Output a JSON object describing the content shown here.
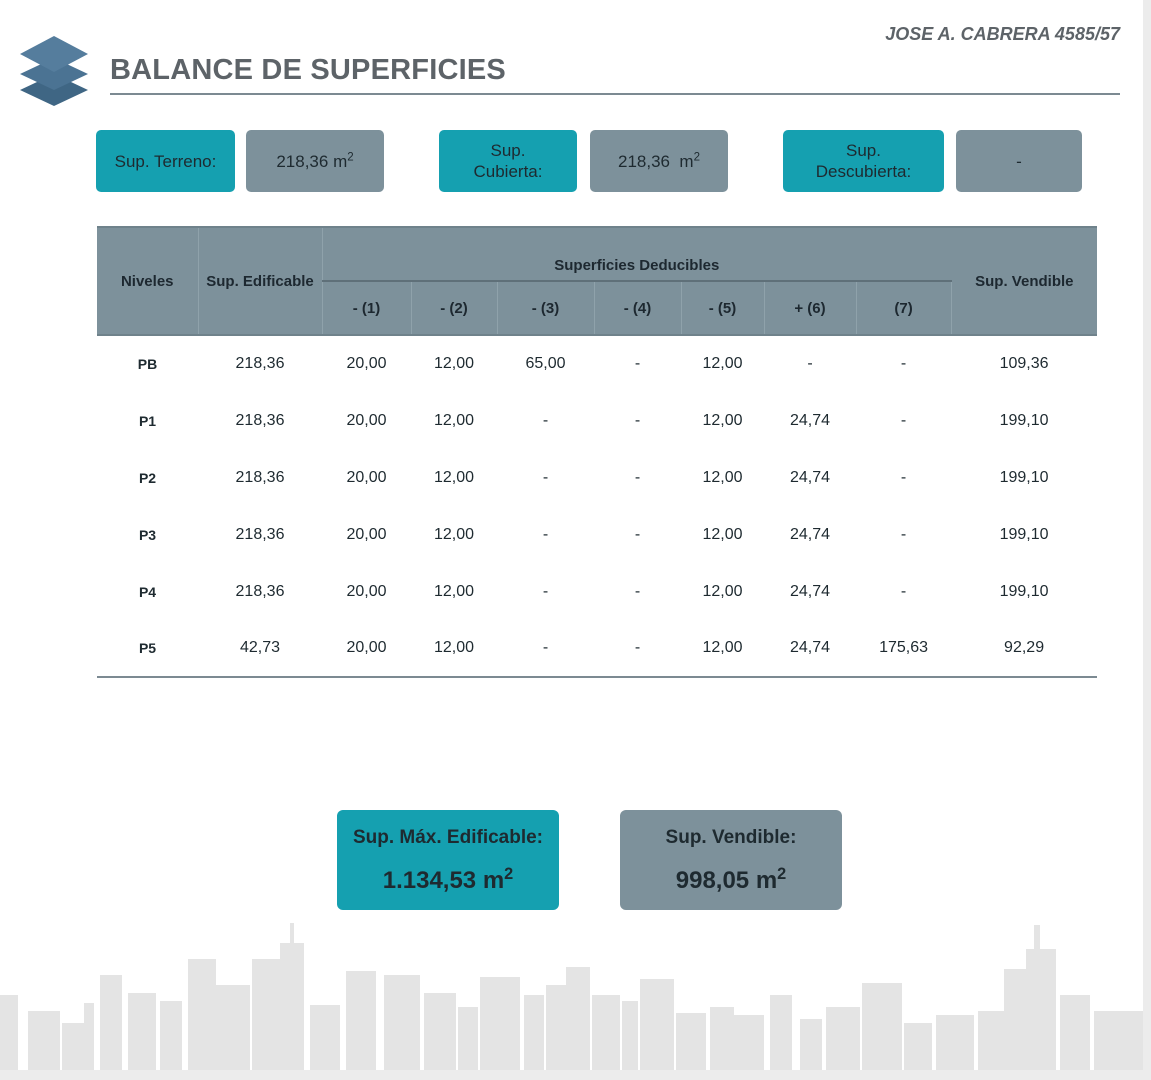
{
  "header": {
    "title": "BALANCE DE SUPERFICIES",
    "address": "JOSE A. CABRERA 4585/57",
    "logo_icon": "layers-icon"
  },
  "chips": {
    "terreno_label": "Sup. Terreno:",
    "terreno_value": "218,36 m",
    "cubierta_label": "Sup.\nCubierta:",
    "cubierta_value": "218,36  m",
    "descubierta_label": "Sup.\nDescubierta:",
    "descubierta_value": "-",
    "unit_exponent": "2"
  },
  "table": {
    "headers": {
      "niveles": "Niveles",
      "edificable": "Sup. Edificable",
      "deducibles": "Superficies Deducibles",
      "vendible": "Sup. Vendible",
      "sub": [
        "- (1)",
        "- (2)",
        "- (3)",
        "- (4)",
        "- (5)",
        "+ (6)",
        "(7)"
      ]
    },
    "rows": [
      [
        "PB",
        "218,36",
        "20,00",
        "12,00",
        "65,00",
        "-",
        "12,00",
        "-",
        "-",
        "109,36"
      ],
      [
        "P1",
        "218,36",
        "20,00",
        "12,00",
        "-",
        "-",
        "12,00",
        "24,74",
        "-",
        "199,10"
      ],
      [
        "P2",
        "218,36",
        "20,00",
        "12,00",
        "-",
        "-",
        "12,00",
        "24,74",
        "-",
        "199,10"
      ],
      [
        "P3",
        "218,36",
        "20,00",
        "12,00",
        "-",
        "-",
        "12,00",
        "24,74",
        "-",
        "199,10"
      ],
      [
        "P4",
        "218,36",
        "20,00",
        "12,00",
        "-",
        "-",
        "12,00",
        "24,74",
        "-",
        "199,10"
      ],
      [
        "P5",
        "42,73",
        "20,00",
        "12,00",
        "-",
        "-",
        "12,00",
        "24,74",
        "175,63",
        "92,29"
      ]
    ]
  },
  "summary": {
    "max_label": "Sup. Máx. Edificable:",
    "max_value": "1.134,53 m",
    "vend_label": "Sup. Vendible:",
    "vend_value": "998,05 m",
    "unit_exponent": "2"
  },
  "colors": {
    "teal": "#15a0b0",
    "slate": "#7d919b",
    "title_grey": "#5d6368",
    "skyline": "#e3e3e3"
  },
  "decor": {
    "skyline_icon": "city-skyline-icon"
  }
}
